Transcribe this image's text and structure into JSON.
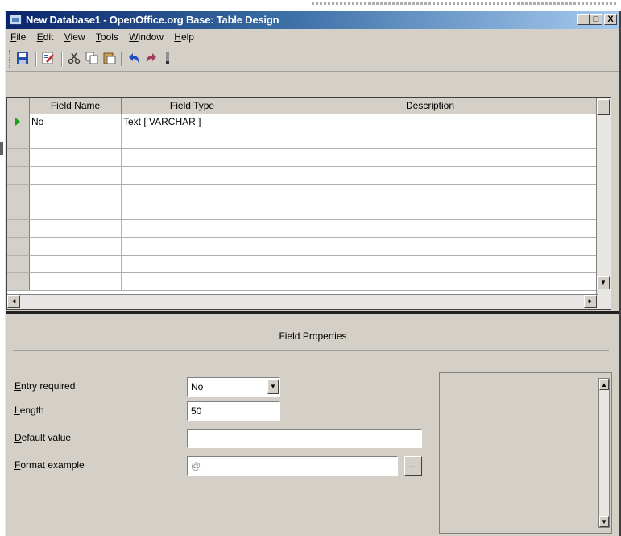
{
  "window": {
    "title": "New Database1 - OpenOffice.org Base: Table Design",
    "buttons": {
      "minimize": "_",
      "maximize": "□",
      "close": "X"
    }
  },
  "menu": [
    "File",
    "Edit",
    "View",
    "Tools",
    "Window",
    "Help"
  ],
  "toolbar": {
    "icons": [
      "save-icon",
      "edit-icon",
      "cut-icon",
      "copy-icon",
      "paste-icon",
      "undo-icon",
      "redo-icon"
    ]
  },
  "table": {
    "columns": [
      "Field Name",
      "Field Type",
      "Description"
    ],
    "rows": [
      {
        "field_name": "No",
        "field_type": "Text [ VARCHAR ]",
        "description": ""
      }
    ]
  },
  "field_properties": {
    "title": "Field Properties",
    "entry_required_label": "Entry required",
    "entry_required_value": "No",
    "length_label": "Length",
    "length_value": "50",
    "default_value_label": "Default value",
    "default_value": "",
    "format_example_label": "Format example",
    "format_example_value": "@",
    "format_button": "..."
  },
  "colors": {
    "title_bar": "#0a246a",
    "chrome": "#d4d0c8",
    "row_indicator": "#18a018"
  }
}
